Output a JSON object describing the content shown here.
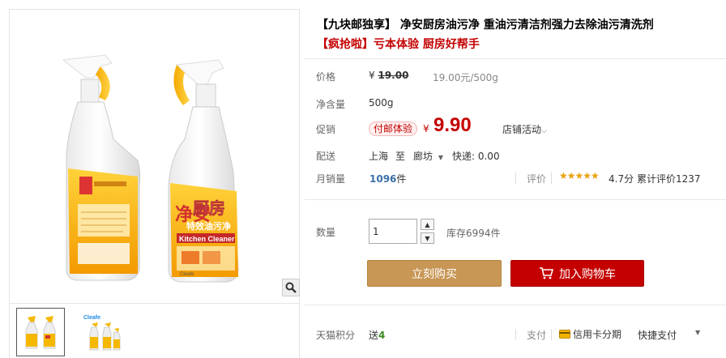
{
  "product": {
    "title": "【九块邮独享】 净安厨房油污净 重油污清洁剂强力去除油污清洗剂",
    "subtitle": "【疯抢啦】亏本体验 厨房好帮手"
  },
  "bottle": {
    "brand": "净安",
    "name_cn": "厨房",
    "sub_cn": "特效油污净",
    "name_en": "Kitchen Cleaner",
    "logo": "Cleafe"
  },
  "price": {
    "label": "价格",
    "currency": "¥",
    "original": "19.00",
    "unit_price": "19.00元/500g"
  },
  "net_content": {
    "label": "净含量",
    "value": "500g"
  },
  "promotion": {
    "label": "促销",
    "badge": "付邮体验",
    "currency": "¥",
    "price": "9.90",
    "shop_activity": "店铺活动"
  },
  "delivery": {
    "label": "配送",
    "from": "上海",
    "to_word": "至",
    "to": "廊坊",
    "shipping": "快递: 0.00"
  },
  "sales": {
    "label": "月销量",
    "count": "1096",
    "unit": "件",
    "rating_label": "评价",
    "stars": "★★★★★",
    "rating": "4.7分",
    "review_text": "累计评价1237"
  },
  "quantity": {
    "label": "数量",
    "value": "1",
    "stock": "库存6994件"
  },
  "buttons": {
    "buy_now": "立刻购买",
    "add_cart": "加入购物车"
  },
  "footer": {
    "points_label": "天猫积分",
    "points_prefix": "送",
    "points_value": "4",
    "pay_label": "支付",
    "credit_card": "信用卡分期",
    "quick_pay": "快捷支付"
  },
  "colors": {
    "accent_red": "#c40000",
    "buy_button": "#c89655",
    "bottle_yellow": "#f5b800"
  }
}
